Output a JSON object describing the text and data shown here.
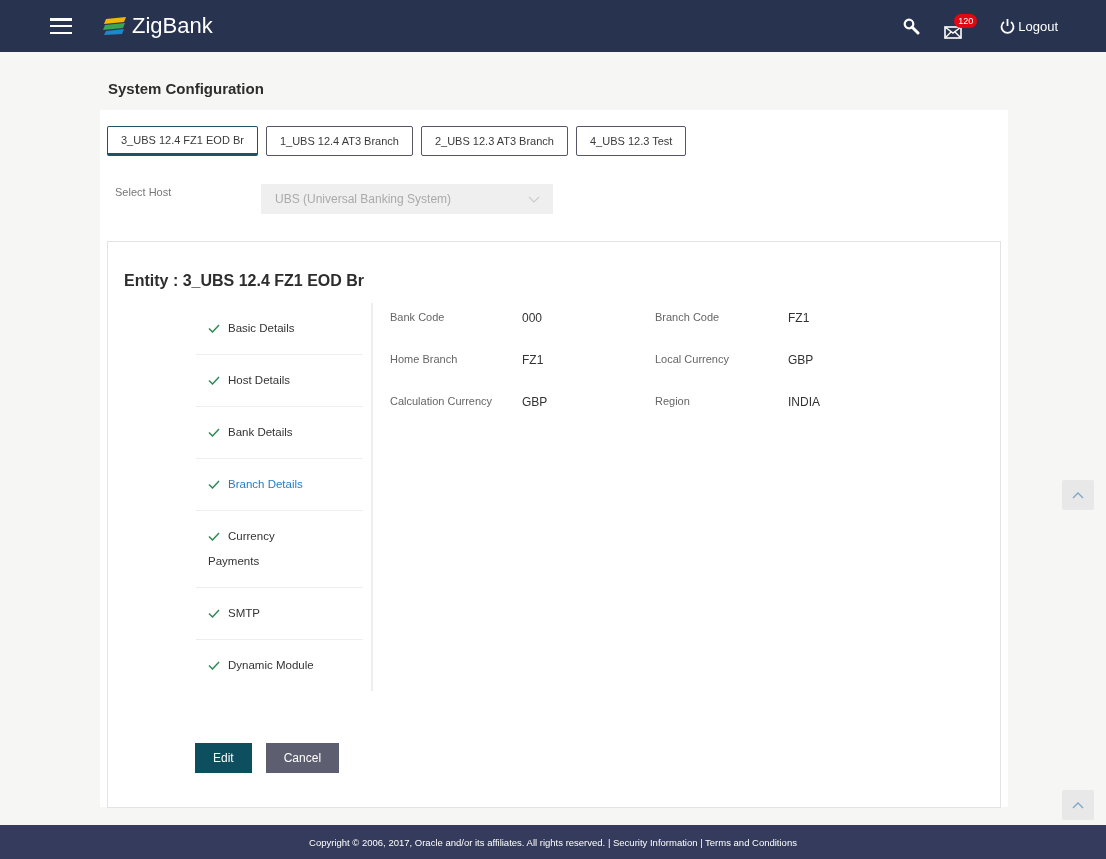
{
  "header": {
    "brand": "ZigBank",
    "mail_badge": "120",
    "logout": "Logout"
  },
  "page_title": "System Configuration",
  "tabs": [
    {
      "label": "3_UBS 12.4 FZ1 EOD Br",
      "selected": true
    },
    {
      "label": "1_UBS 12.4 AT3 Branch",
      "selected": false
    },
    {
      "label": "2_UBS 12.3 AT3 Branch",
      "selected": false
    },
    {
      "label": "4_UBS 12.3 Test",
      "selected": false
    }
  ],
  "select_host": {
    "label": "Select Host",
    "value": "UBS (Universal Banking System)",
    "disabled": true
  },
  "entity_title": "Entity : 3_UBS 12.4 FZ1 EOD Br",
  "steps": [
    {
      "label": "Basic Details",
      "done": true,
      "selected": false
    },
    {
      "label": "Host Details",
      "done": true,
      "selected": false
    },
    {
      "label": "Bank Details",
      "done": true,
      "selected": false
    },
    {
      "label": "Branch Details",
      "done": true,
      "selected": true
    },
    {
      "label": "Currency Payments",
      "done": true,
      "selected": false
    },
    {
      "label": "SMTP",
      "done": true,
      "selected": false
    },
    {
      "label": "Dynamic Module",
      "done": true,
      "selected": false
    }
  ],
  "fields": [
    {
      "label": "Bank Code",
      "value": "000"
    },
    {
      "label": "Branch Code",
      "value": "FZ1"
    },
    {
      "label": "Home Branch",
      "value": "FZ1"
    },
    {
      "label": "Local Currency",
      "value": "GBP"
    },
    {
      "label": "Calculation Currency",
      "value": "GBP"
    },
    {
      "label": "Region",
      "value": "INDIA"
    }
  ],
  "buttons": [
    {
      "label": "Edit",
      "kind": "primary"
    },
    {
      "label": "Cancel",
      "kind": "secondary"
    }
  ],
  "footer": {
    "copyright": "Copyright © 2006, 2017, Oracle and/or its affiliates. All rights reserved.",
    "separator": "|",
    "links": [
      "Security Information",
      "Terms and Conditions"
    ]
  }
}
